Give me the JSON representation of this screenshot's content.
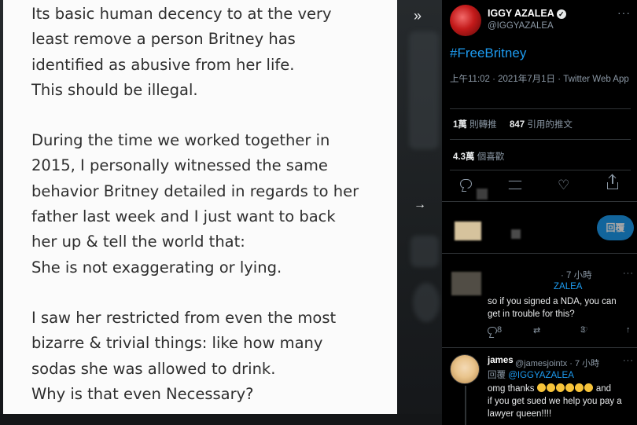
{
  "note": {
    "paragraphs": [
      [
        "Its basic human decency to at the very",
        "least remove a person Britney has",
        "identified as abusive from her life.",
        "This should be illegal."
      ],
      [
        "During the time we worked together in",
        "2015, I personally witnessed the same",
        "behavior Britney detailed in regards to her",
        "father last week and I just want to back",
        "her up & tell the world that:",
        "She is not exaggerating or lying."
      ],
      [
        "I saw her restricted from even the most",
        "bizarre & trivial things: like how many",
        "sodas she was allowed to drink.",
        "Why is that even Necessary?"
      ]
    ]
  },
  "nav": {
    "collapse_icon": "double-chevron-right-icon",
    "next_icon": "arrow-right-icon"
  },
  "tweet": {
    "author_name": "IGGY AZALEA",
    "author_handle": "@IGGYAZALEA",
    "hashtag": "#FreeBritney",
    "timestamp": "上午11:02 · 2021年7月1日 · Twitter Web App",
    "retweets_count": "1萬",
    "retweets_label": "則轉推",
    "quotes_count": "847",
    "quotes_label": "引用的推文",
    "likes_count": "4.3萬",
    "likes_label": "個喜歡",
    "accent_color": "#1d9bf0"
  },
  "reply_box": {
    "button_label": "回覆"
  },
  "reply1": {
    "meta": "· 7 小時",
    "mention_fragment": "ZALEA",
    "text_lines": [
      "so if you signed a NDA, you can",
      "get in trouble for this?"
    ],
    "reply_count": "8",
    "like_count": "3"
  },
  "reply2": {
    "name": "james",
    "handle_time": "@jamesjointx · 7 小時",
    "reply_prefix": "回覆",
    "reply_to": "@IGGYAZALEA",
    "text_line1_start": "omg thanks",
    "text_line1_end": "and",
    "text_lines_rest": [
      "if you get sued we help you pay a",
      "lawyer queen!!!!"
    ]
  }
}
